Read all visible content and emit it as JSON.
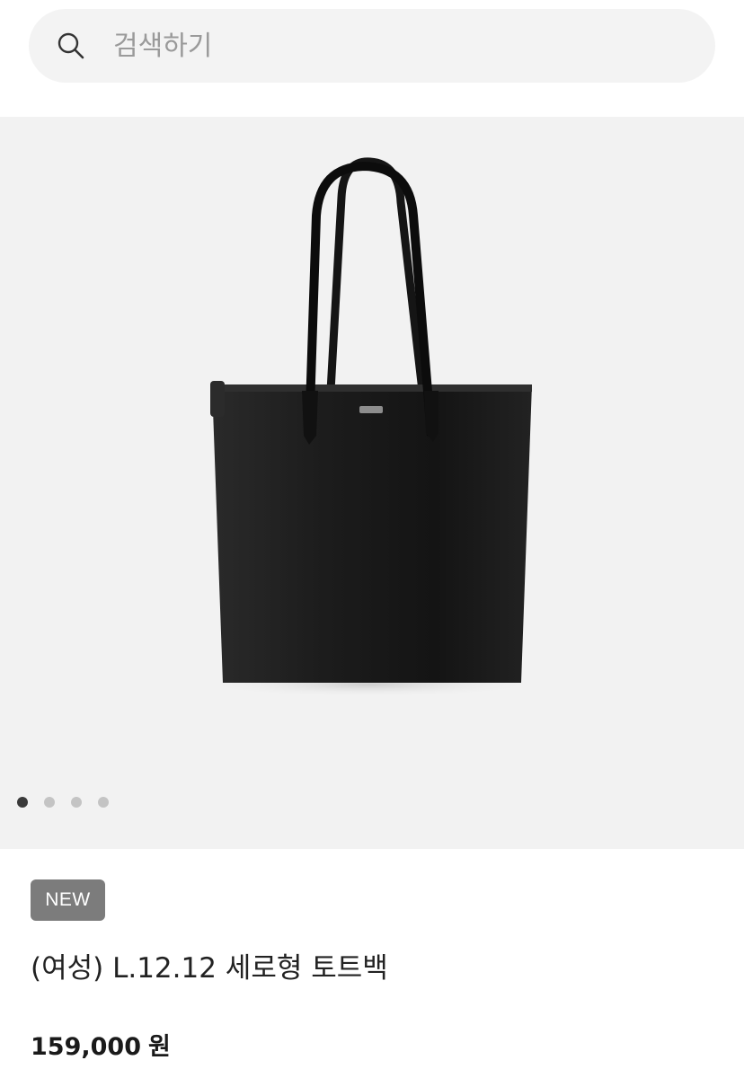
{
  "search": {
    "placeholder": "검색하기",
    "icon": "search-icon"
  },
  "gallery": {
    "image_description_icon": "product-photo",
    "dots_total": 4,
    "active_index": 0
  },
  "product": {
    "badge": "NEW",
    "title": "(여성) L.12.12 세로형 토트백",
    "price_value": "159,000",
    "price_unit": "원"
  },
  "colors": {
    "search_bg": "#f3f3f3",
    "gallery_bg": "#f2f2f2",
    "badge_bg": "#7c7c7c",
    "dot_active": "#3a3a3a",
    "dot_inactive": "#c4c4c4"
  }
}
